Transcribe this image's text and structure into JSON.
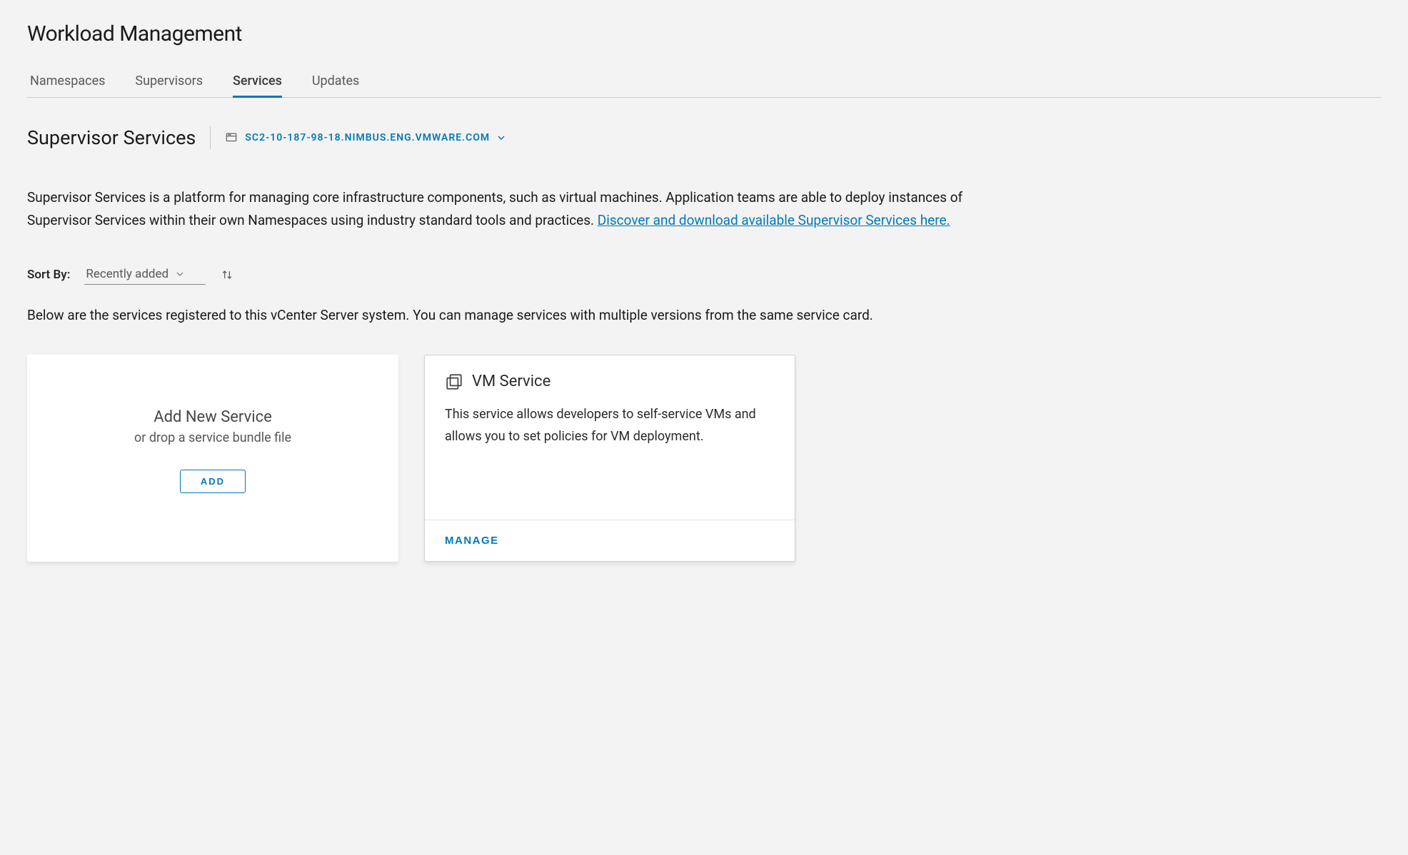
{
  "page_title": "Workload Management",
  "tabs": [
    {
      "label": "Namespaces"
    },
    {
      "label": "Supervisors"
    },
    {
      "label": "Services"
    },
    {
      "label": "Updates"
    }
  ],
  "active_tab_index": 2,
  "section": {
    "title": "Supervisor Services",
    "supervisor_hostname": "SC2-10-187-98-18.NIMBUS.ENG.VMWARE.COM"
  },
  "description": {
    "body": "Supervisor Services is a platform for managing core infrastructure components, such as virtual machines. Application teams are able to deploy instances of Supervisor Services within their own Namespaces using industry standard tools and practices. ",
    "link_text": "Discover and download available Supervisor Services here."
  },
  "sort": {
    "label": "Sort By:",
    "value": "Recently added"
  },
  "subdescription": "Below are the services registered to this vCenter Server system. You can manage services with multiple versions from the same service card.",
  "add_card": {
    "title": "Add New Service",
    "subtitle": "or drop a service bundle file",
    "button": "ADD"
  },
  "service_cards": [
    {
      "title": "VM Service",
      "description": "This service allows developers to self-service VMs and allows you to set policies for VM deployment.",
      "manage_label": "MANAGE"
    }
  ]
}
